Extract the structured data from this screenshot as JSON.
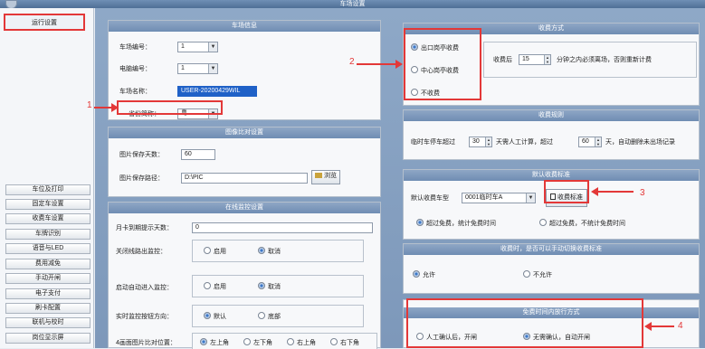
{
  "window": {
    "title": "车场设置"
  },
  "sidebar": {
    "active_item": "运行设置",
    "items": [
      "车位及打印",
      "固定车设置",
      "收费车设置",
      "车牌识别",
      "语音与LED",
      "费用减免",
      "手动开闸",
      "电子支付",
      "刷卡配置",
      "联机与校时",
      "岗位显示屏"
    ]
  },
  "parking_info": {
    "header": "车场信息",
    "lot_id_label": "车场编号：",
    "lot_id_value": "1",
    "pc_id_label": "电脑编号：",
    "pc_id_value": "1",
    "lot_name_label": "车场名称：",
    "lot_name_value": "USER-20200429WIL",
    "province_label": "省份简称：",
    "province_value": "粤"
  },
  "image_compare": {
    "header": "图像比对设置",
    "keep_days_label": "图片保存天数：",
    "keep_days_value": "60",
    "path_label": "图片保存路径：",
    "path_value": "D:\\PIC",
    "browse_label": "浏览"
  },
  "monitor": {
    "header": "在线监控设置",
    "monthly_expire_label": "月卡到期提示天数：",
    "monthly_expire_value": "0",
    "exit_monitor_label": "关闭线路出监控：",
    "auto_enter_label": "启动自动进入监控：",
    "direction_label": "实时监控按钮方向：",
    "position_label": "4画面图片比对位置：",
    "enable": "启用",
    "cancel": "取消",
    "default": "默认",
    "bottom": "底部",
    "positions": [
      "左上角",
      "左下角",
      "右上角",
      "右下角"
    ]
  },
  "charge_mode": {
    "header": "收费方式",
    "options": [
      "出口岗亭收费",
      "中心岗亭收费",
      "不收费"
    ],
    "after_label": "收费后",
    "minutes_value": "15",
    "after_text": "分钟之内必须离场，否则重新计费"
  },
  "charge_rules": {
    "header": "收费规则",
    "temp_label": "临时车停车超过",
    "temp_value": "30",
    "temp_text": "天需人工计算，超过",
    "delete_value": "60",
    "delete_text": "天，自动删除未出场记录"
  },
  "default_standard": {
    "header": "默认收费标准",
    "type_label": "默认收费车型",
    "type_value": "0001临时车A",
    "standard_button": "收费标准",
    "over_options": [
      "超过免费，统计免费时间",
      "超过免费，不统计免费时间"
    ]
  },
  "manual_switch": {
    "header": "收费时，是否可以手动切换收费标准",
    "allow": "允许",
    "disallow": "不允许"
  },
  "free_time": {
    "header": "免费时间内放行方式",
    "manual": "人工确认后，开闸",
    "auto": "无需确认，自动开闸"
  },
  "annotations": {
    "n1": "1",
    "n2": "2",
    "n3": "3",
    "n4": "4"
  },
  "colors": {
    "highlight": "#e33838",
    "header": "#7d98ba"
  }
}
